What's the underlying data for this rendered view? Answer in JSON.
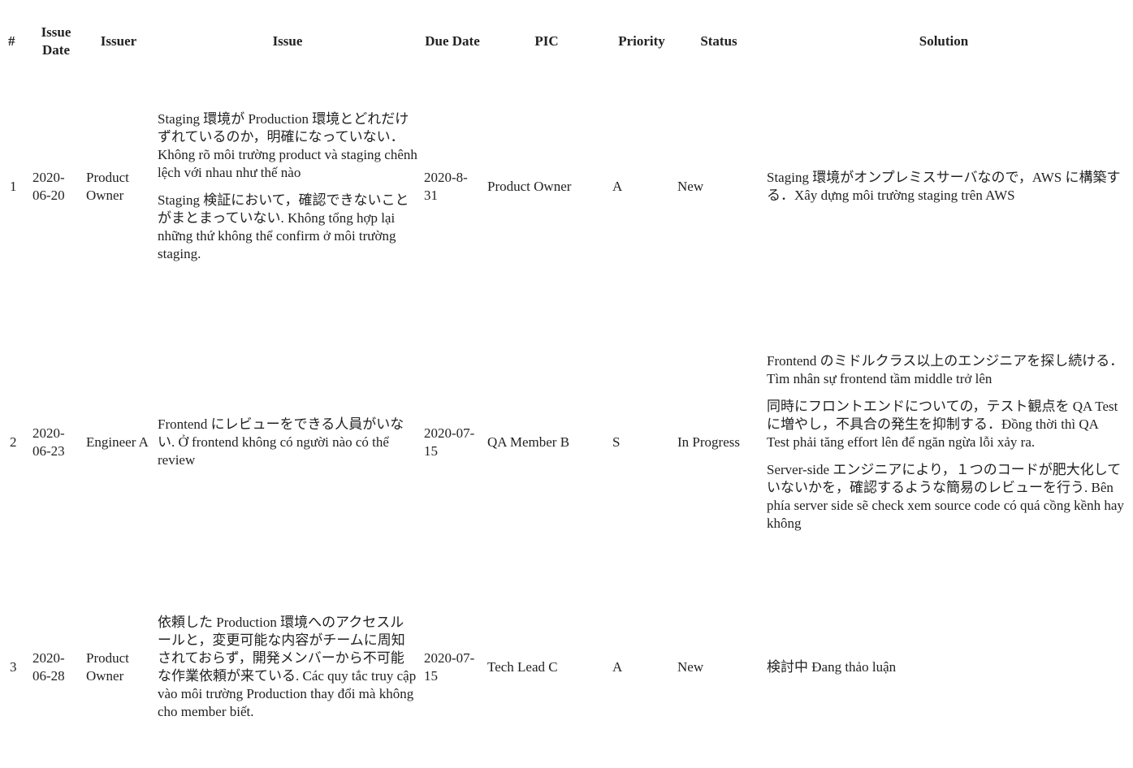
{
  "headers": {
    "num": "#",
    "issue_date_1": "Issue",
    "issue_date_2": "Date",
    "issuer": "Issuer",
    "issue": "Issue",
    "due_date": "Due Date",
    "pic": "PIC",
    "priority": "Priority",
    "status": "Status",
    "solution": "Solution"
  },
  "rows": [
    {
      "num": "1",
      "issue_date": "2020-06-20",
      "issuer": "Product Owner",
      "issue": [
        "Staging 環境が Production 環境とどれだけずれているのか，明確になっていない．Không rõ môi trường product và staging chênh lệch với nhau như thế nào",
        "Staging 検証において，確認できないことがまとまっていない. Không tổng hợp lại những thứ không thể confirm ở môi trường staging."
      ],
      "due_date": "2020-8-31",
      "pic": "Product Owner",
      "priority": "A",
      "status": "New",
      "solution": [
        "Staging 環境がオンプレミスサーバなので，AWS に構築する．Xây dựng môi trường staging trên AWS"
      ]
    },
    {
      "num": "2",
      "issue_date": "2020-06-23",
      "issuer": "Engineer A",
      "issue": [
        "Frontend にレビューをできる人員がいない. Ở frontend không có người nào có thể review"
      ],
      "due_date": "2020-07-15",
      "pic": "QA Member B",
      "priority": "S",
      "status": "In Progress",
      "solution": [
        "Frontend のミドルクラス以上のエンジニアを探し続ける．Tìm nhân sự frontend tầm middle trở lên",
        "同時にフロントエンドについての，テスト観点を QA Test に増やし，不具合の発生を抑制する．Đồng thời thì QA Test phải tăng effort lên để ngăn ngừa lỗi xảy ra.",
        "Server-side エンジニアにより，１つのコードが肥大化していないかを，確認するような簡易のレビューを行う. Bên phía server side sẽ check xem source code có quá cồng kềnh hay không"
      ]
    },
    {
      "num": "3",
      "issue_date": "2020-06-28",
      "issuer": "Product Owner",
      "issue": [
        "依頼した Production 環境へのアクセスルールと，変更可能な内容がチームに周知されておらず，開発メンバーから不可能な作業依頼が来ている. Các quy tắc truy cập vào môi trường Production thay đổi mà không cho member biết."
      ],
      "due_date": "2020-07-15",
      "pic": "Tech Lead C",
      "priority": "A",
      "status": "New",
      "solution": [
        "検討中 Đang thảo luận"
      ]
    }
  ]
}
